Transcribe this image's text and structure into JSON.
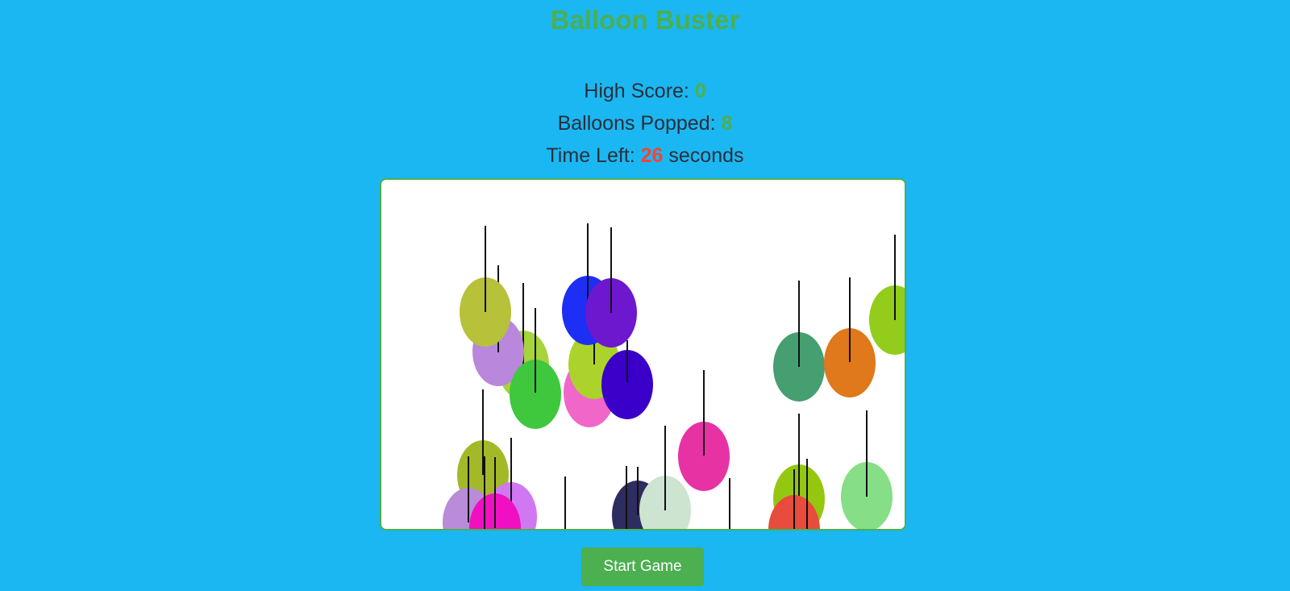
{
  "title": "Balloon Buster",
  "stats": {
    "high_score_label": "High Score: ",
    "high_score": "0",
    "high_score_color": "#4CAF50",
    "popped_label": "Balloons Popped: ",
    "popped": "8",
    "popped_color": "#4CAF50",
    "time_label": "Time Left: ",
    "time_left": "26",
    "time_color": "#F44336",
    "time_unit": " seconds"
  },
  "start_button": "Start Game",
  "balloon_colors": [
    "#A7D33C",
    "#B987DC",
    "#B7C139",
    "#3FC73E",
    "#F167C9",
    "#ABD32B",
    "#1D2EF5",
    "#6D17CE",
    "#3A00C9",
    "#E732A3",
    "#459F70",
    "#E0781C",
    "#93CC1A",
    "#A3B928",
    "#B98BD8",
    "#CF78F1",
    "#F00FC1",
    "#2E2D5F",
    "#CDE4D0",
    "#94C70F",
    "#86DE86",
    "#E74C3C"
  ]
}
